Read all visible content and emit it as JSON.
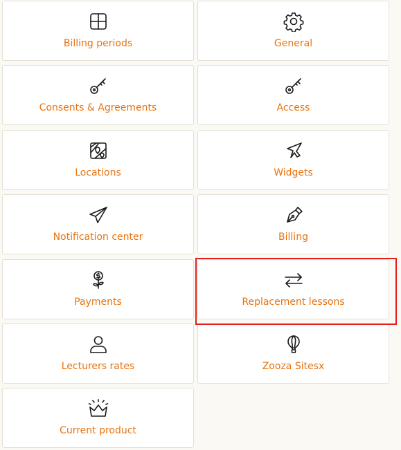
{
  "accent_color": "#e8730f",
  "highlight_color": "#e0201e",
  "tiles": {
    "billing_periods": {
      "label": "Billing periods",
      "icon": "grid-icon"
    },
    "general": {
      "label": "General",
      "icon": "gear-icon"
    },
    "consents": {
      "label": "Consents & Agreements",
      "icon": "key-icon"
    },
    "access": {
      "label": "Access",
      "icon": "key-icon"
    },
    "locations": {
      "label": "Locations",
      "icon": "map-icon"
    },
    "widgets": {
      "label": "Widgets",
      "icon": "cursor-arrow-icon"
    },
    "notification_center": {
      "label": "Notification center",
      "icon": "paper-plane-icon"
    },
    "billing": {
      "label": "Billing",
      "icon": "pen-nib-icon"
    },
    "payments": {
      "label": "Payments",
      "icon": "money-plant-icon"
    },
    "replacement_lessons": {
      "label": "Replacement lessons",
      "icon": "swap-arrows-icon"
    },
    "lecturers_rates": {
      "label": "Lecturers rates",
      "icon": "user-icon"
    },
    "zooza_sites": {
      "label": "Zooza Sitesx",
      "icon": "hot-air-balloon-icon"
    },
    "current_product": {
      "label": "Current product",
      "icon": "crown-icon"
    }
  }
}
